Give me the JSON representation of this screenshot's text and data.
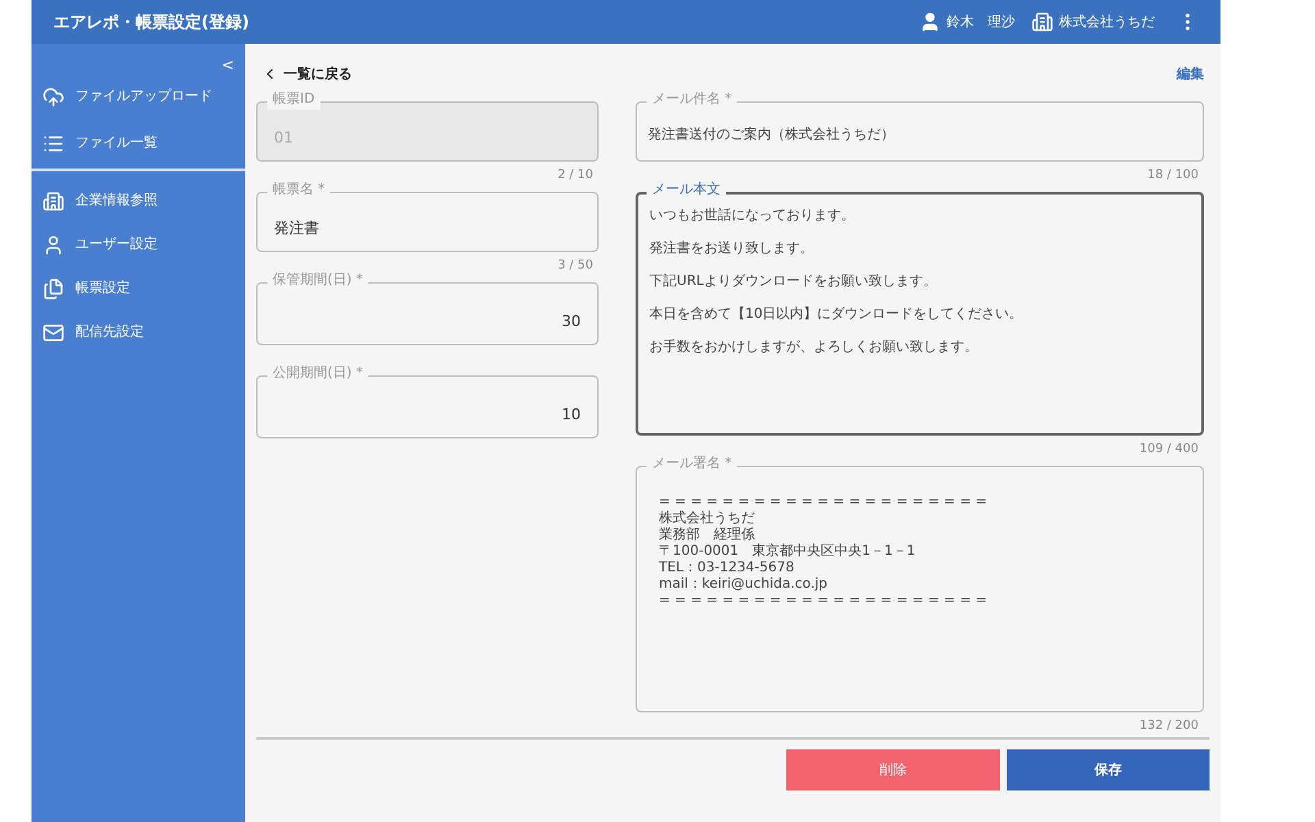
{
  "header": {
    "title": "エアレポ・帳票設定(登録)",
    "user": "鈴木　理沙",
    "company": "株式会社うちだ"
  },
  "sidebar": {
    "collapse": "<",
    "groups": [
      [
        {
          "label": "ファイルアップロード",
          "selected": false
        },
        {
          "label": "ファイル一覧",
          "selected": false
        }
      ],
      [
        {
          "label": "企業情報参照",
          "selected": false
        },
        {
          "label": "ユーザー設定",
          "selected": false
        },
        {
          "label": "帳票設定",
          "selected": false
        },
        {
          "label": "配信先設定",
          "selected": false
        }
      ]
    ]
  },
  "toolbar": {
    "back": "一覧に戻る",
    "edit": "編集"
  },
  "left_fields": [
    {
      "label": "帳票ID",
      "value": "01",
      "counter": "2 / 10",
      "disabled": true,
      "kind": "text"
    },
    {
      "label": "帳票名 *",
      "value": "発注書",
      "counter": "3 / 50",
      "disabled": false,
      "kind": "text"
    },
    {
      "label": "保管期間(日) *",
      "value": "30",
      "disabled": false,
      "kind": "number"
    },
    {
      "label": "公開期間(日) *",
      "value": "10",
      "disabled": false,
      "kind": "number"
    }
  ],
  "right_fields": [
    {
      "label": "メール件名 *",
      "lines": [
        "発注書送付のご案内（株式会社うちだ）"
      ],
      "counter": "18 / 100",
      "focused": false,
      "kind": "single"
    },
    {
      "label": "メール本文",
      "lines": [
        "いつもお世話になっております。",
        "発注書をお送り致します。",
        "下記URLよりダウンロードをお願い致します。",
        "本日を含めて【10日以内】にダウンロードをしてください。",
        "お手数をおかけしますが、よろしくお願い致します。"
      ],
      "counter": "109 / 400",
      "focused": true,
      "kind": "body"
    },
    {
      "label": "メール署名 *",
      "lines": [
        "= = = = = = = = = = = = = = = = = = = = =",
        "株式会社うちだ",
        "業務部　経理係",
        "〒100-0001　東京都中央区中央1－1－1",
        "TEL：03-1234-5678",
        "mail：keiri@uchida.co.jp",
        "= = = = = = = = = = = = = = = = = = = = ="
      ],
      "counter": "132 / 200",
      "focused": false,
      "kind": "signature"
    }
  ],
  "buttons": {
    "delete": "削除",
    "save": "保存"
  }
}
